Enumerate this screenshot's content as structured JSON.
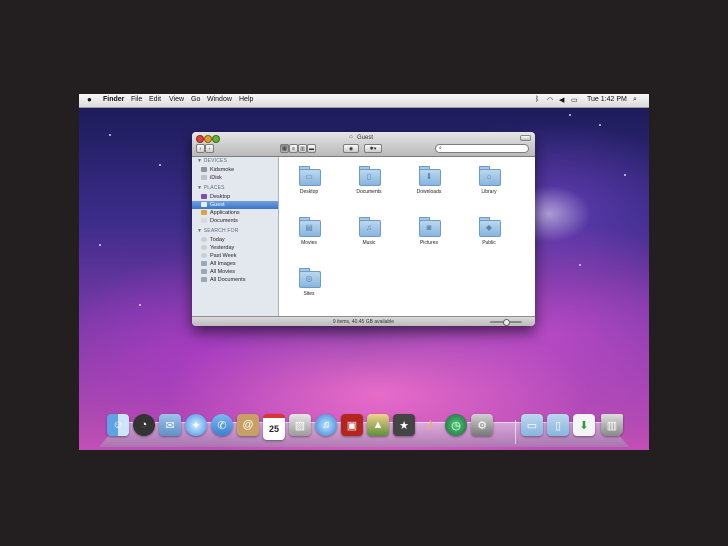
{
  "menubar": {
    "apple": "",
    "app": "Finder",
    "items": [
      "File",
      "Edit",
      "View",
      "Go",
      "Window",
      "Help"
    ],
    "clock": "Tue 1:42 PM",
    "status_icons": [
      "bluetooth-icon",
      "wifi-icon",
      "volume-icon",
      "battery-icon",
      "spotlight-icon"
    ]
  },
  "window": {
    "title": "Guest",
    "search_placeholder": "",
    "status": "9 items, 40.45 GB available"
  },
  "sidebar": {
    "devices_header": "DEVICES",
    "devices": [
      "Kidsmoke",
      "iDisk"
    ],
    "places_header": "PLACES",
    "places": [
      "Desktop",
      "Guest",
      "Applications",
      "Documents"
    ],
    "search_header": "SEARCH FOR",
    "searches": [
      "Today",
      "Yesterday",
      "Past Week",
      "All Images",
      "All Movies",
      "All Documents"
    ],
    "selected": "Guest"
  },
  "folders": [
    "Desktop",
    "Documents",
    "Downloads",
    "Library",
    "Movies",
    "Music",
    "Pictures",
    "Public",
    "Sites"
  ],
  "dock": {
    "items": [
      "finder-icon",
      "dashboard-icon",
      "mail-icon",
      "safari-icon",
      "ichat-icon",
      "address-book-icon",
      "ical-icon",
      "preview-icon",
      "itunes-icon",
      "photo-booth-icon",
      "iphoto-icon",
      "imovie-icon",
      "garageband-icon",
      "time-machine-icon",
      "system-preferences-icon",
      "applications-stack-icon",
      "documents-stack-icon",
      "downloads-stack-icon",
      "trash-icon"
    ],
    "ical_day": "25"
  }
}
